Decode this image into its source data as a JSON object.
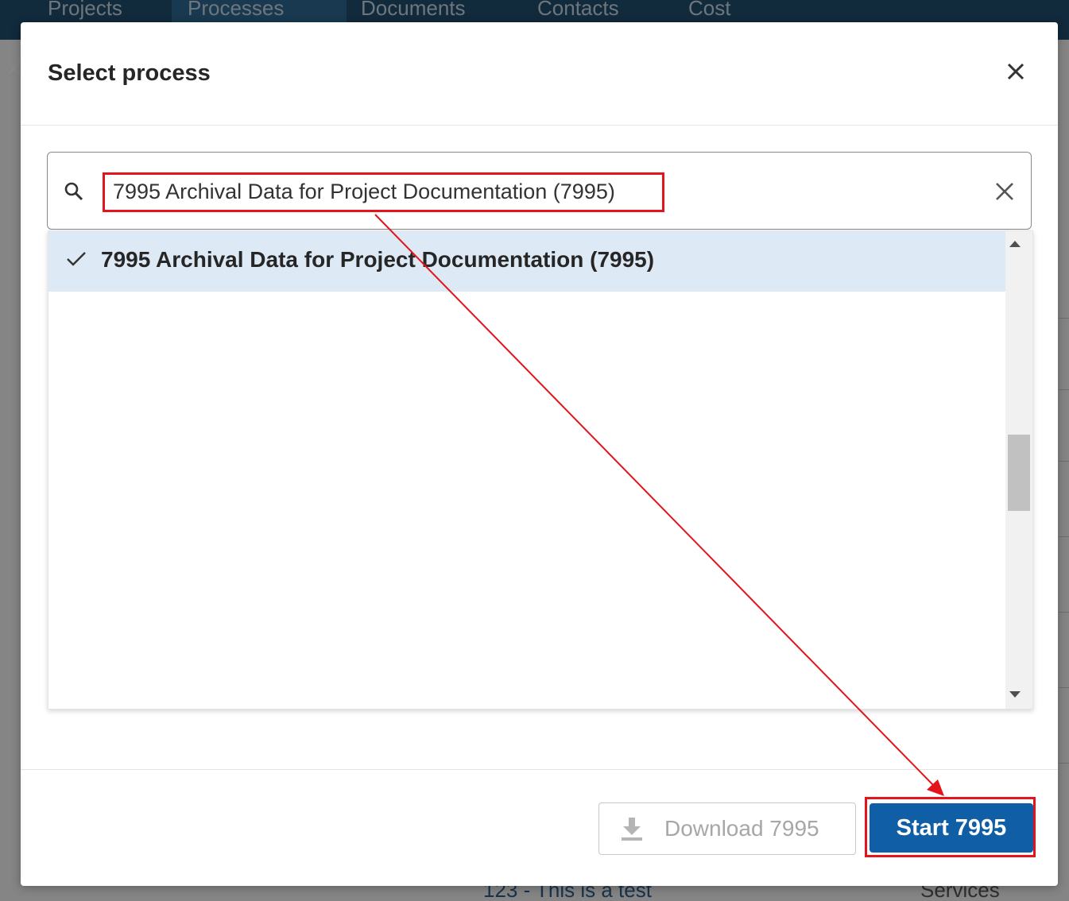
{
  "background_app": {
    "tabs": [
      "Projects",
      "Processes",
      "Documents",
      "Contacts",
      "Cost"
    ],
    "active_tab_index": 1,
    "bottom_row_text": "123 - This is a test",
    "bottom_row_right": "Services"
  },
  "modal": {
    "title": "Select process",
    "close_icon": "close-icon",
    "search": {
      "icon": "search-icon",
      "value": "7995 Archival Data for Project Documentation (7995)",
      "clear_icon": "close-icon"
    },
    "options": [
      {
        "label": "7995 Archival Data for Project Documentation (7995)",
        "selected": true,
        "icon": "check-icon"
      }
    ],
    "buttons": {
      "download": {
        "label": "Download 7995",
        "icon": "download-icon",
        "disabled": true
      },
      "start": {
        "label": "Start 7995",
        "color": "#0f5ea6"
      }
    }
  },
  "annotation": {
    "color": "#e3141c",
    "arrow_from": "search-input",
    "arrow_to": "start-button"
  }
}
